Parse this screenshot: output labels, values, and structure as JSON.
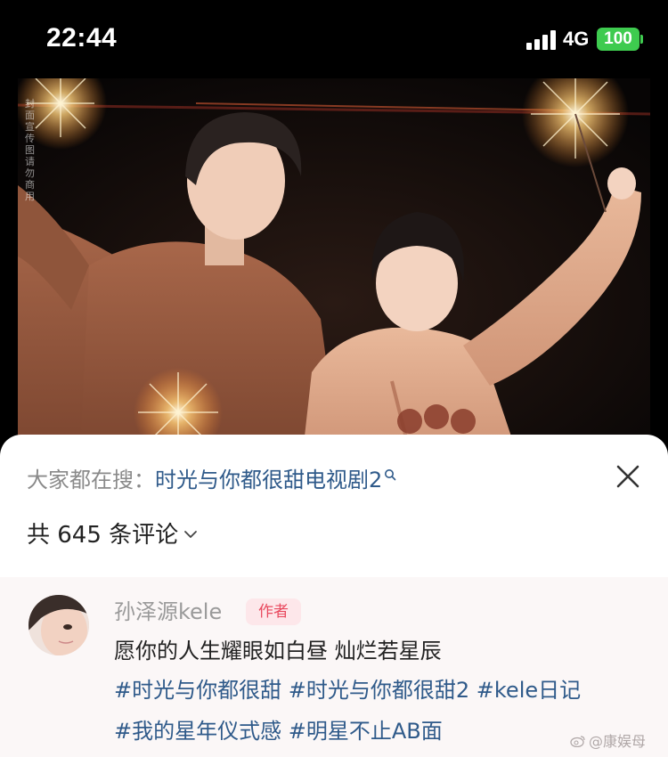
{
  "status_bar": {
    "time": "22:44",
    "network": "4G",
    "battery": "100",
    "battery_color": "#3ecb4f"
  },
  "photo": {
    "vertical_watermark": "封面宣传图 请勿商用",
    "description_icon": "photo"
  },
  "sheet": {
    "search_prefix": "大家都在搜：",
    "search_term": "时光与你都很甜电视剧2",
    "comment_count_label": "共 645 条评论"
  },
  "comment": {
    "username": "孙泽源kele",
    "badge": "作者",
    "line1": "愿你的人生耀眼如白昼 灿烂若星辰",
    "tags_line2": [
      "#时光与你都很甜",
      "#时光与你都很甜2",
      "#kele日记"
    ],
    "tags_line3": [
      "#我的星年仪式感",
      "#明星不止AB面"
    ]
  },
  "watermark": {
    "text": "@康娱母"
  },
  "colors": {
    "link": "#2f5a8a",
    "badge_text": "#e94a5f",
    "badge_bg": "#fde7ea"
  }
}
